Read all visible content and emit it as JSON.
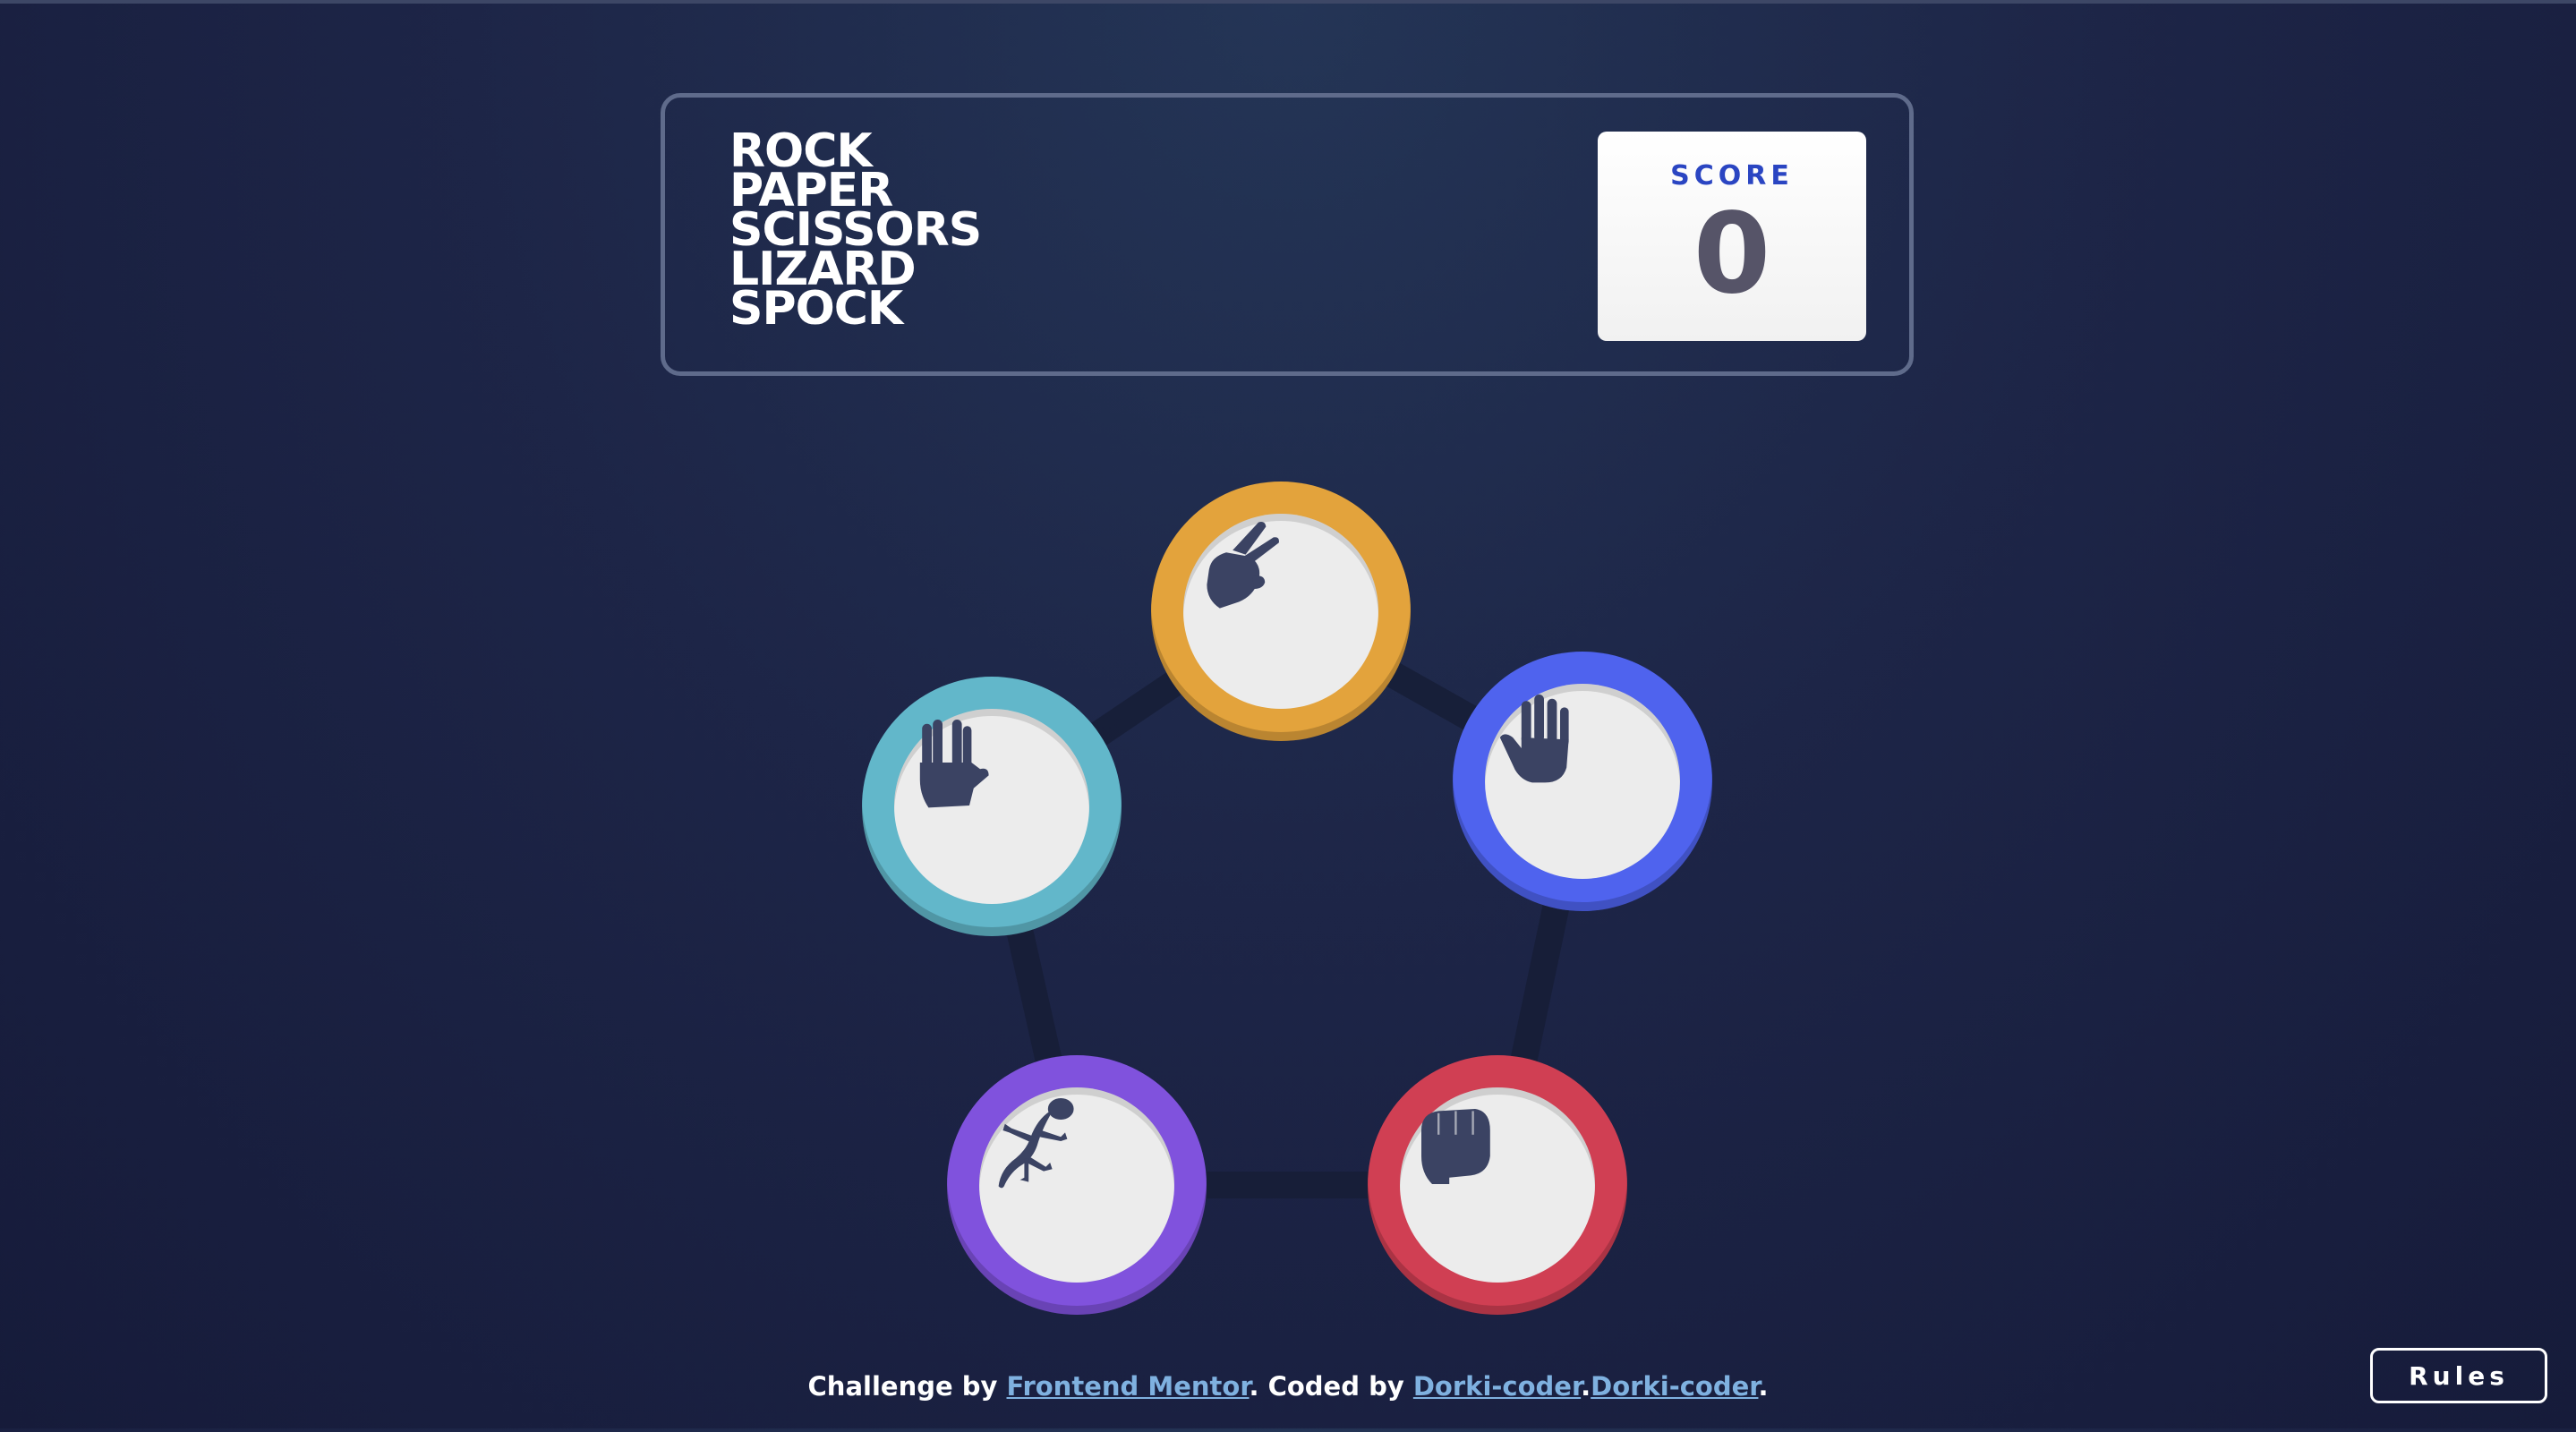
{
  "header": {
    "title_lines": [
      "ROCK",
      "PAPER",
      "SCISSORS",
      "LIZARD",
      "SPOCK"
    ],
    "score_label": "SCORE",
    "score_value": "0"
  },
  "board": {
    "tokens": [
      {
        "id": "scissors",
        "icon": "scissors-hand-icon",
        "color": "#e3a33c"
      },
      {
        "id": "paper",
        "icon": "paper-hand-icon",
        "color": "#4f63ee"
      },
      {
        "id": "rock",
        "icon": "rock-fist-icon",
        "color": "#d03f53"
      },
      {
        "id": "lizard",
        "icon": "lizard-icon",
        "color": "#8052dd"
      },
      {
        "id": "spock",
        "icon": "spock-hand-icon",
        "color": "#62b7ca"
      }
    ]
  },
  "footer": {
    "prefix": "Challenge by ",
    "link1": "Frontend Mentor",
    "middle": ". Coded by ",
    "link2": "Dorki-coder",
    "separator": ".",
    "link3": "Dorki-coder",
    "suffix": "."
  },
  "rules_button": "Rules",
  "colors": {
    "background": "#1d2547",
    "icon": "#3b4363",
    "score_label": "#2a45c2",
    "link": "#7fb1e0"
  }
}
